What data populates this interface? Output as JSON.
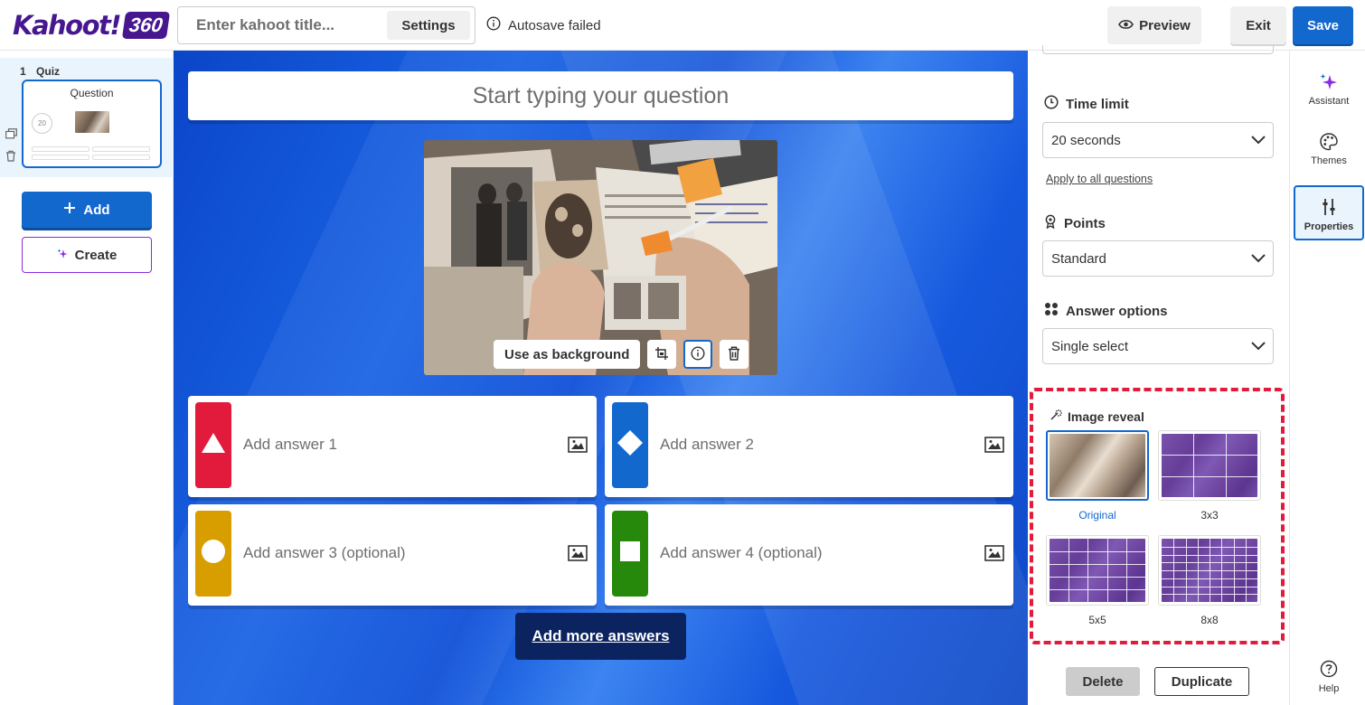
{
  "header": {
    "logo_text": "Kahoot!",
    "logo_badge": "360",
    "title_placeholder": "Enter kahoot title...",
    "settings_label": "Settings",
    "autosave_status": "Autosave failed",
    "preview_label": "Preview",
    "exit_label": "Exit",
    "save_label": "Save"
  },
  "sidebar": {
    "slide_number": "1",
    "slide_type": "Quiz",
    "slide_title": "Question",
    "slide_timer": "20",
    "add_label": "Add",
    "create_label": "Create"
  },
  "editor": {
    "question_placeholder": "Start typing your question",
    "use_background_label": "Use as background",
    "answers": [
      {
        "label": "Add answer 1",
        "color": "#e21b3c",
        "shape": "triangle"
      },
      {
        "label": "Add answer 2",
        "color": "#1368ce",
        "shape": "diamond"
      },
      {
        "label": "Add answer 3 (optional)",
        "color": "#d89e00",
        "shape": "circle"
      },
      {
        "label": "Add answer 4 (optional)",
        "color": "#26890c",
        "shape": "square"
      }
    ],
    "add_more_label": "Add more answers"
  },
  "properties": {
    "time_limit_label": "Time limit",
    "time_limit_value": "20 seconds",
    "apply_all_label": "Apply to all questions",
    "points_label": "Points",
    "points_value": "Standard",
    "answer_options_label": "Answer options",
    "answer_options_value": "Single select",
    "image_reveal_label": "Image reveal",
    "reveal_options": [
      "Original",
      "3x3",
      "5x5",
      "8x8"
    ],
    "reveal_selected": "Original",
    "delete_label": "Delete",
    "duplicate_label": "Duplicate"
  },
  "rail": {
    "assistant_label": "Assistant",
    "themes_label": "Themes",
    "properties_label": "Properties",
    "help_label": "Help"
  },
  "colors": {
    "brand_purple": "#46178f",
    "primary_blue": "#1368ce",
    "highlight_red": "#e21b3c",
    "add_more_bg": "#0b2460"
  }
}
